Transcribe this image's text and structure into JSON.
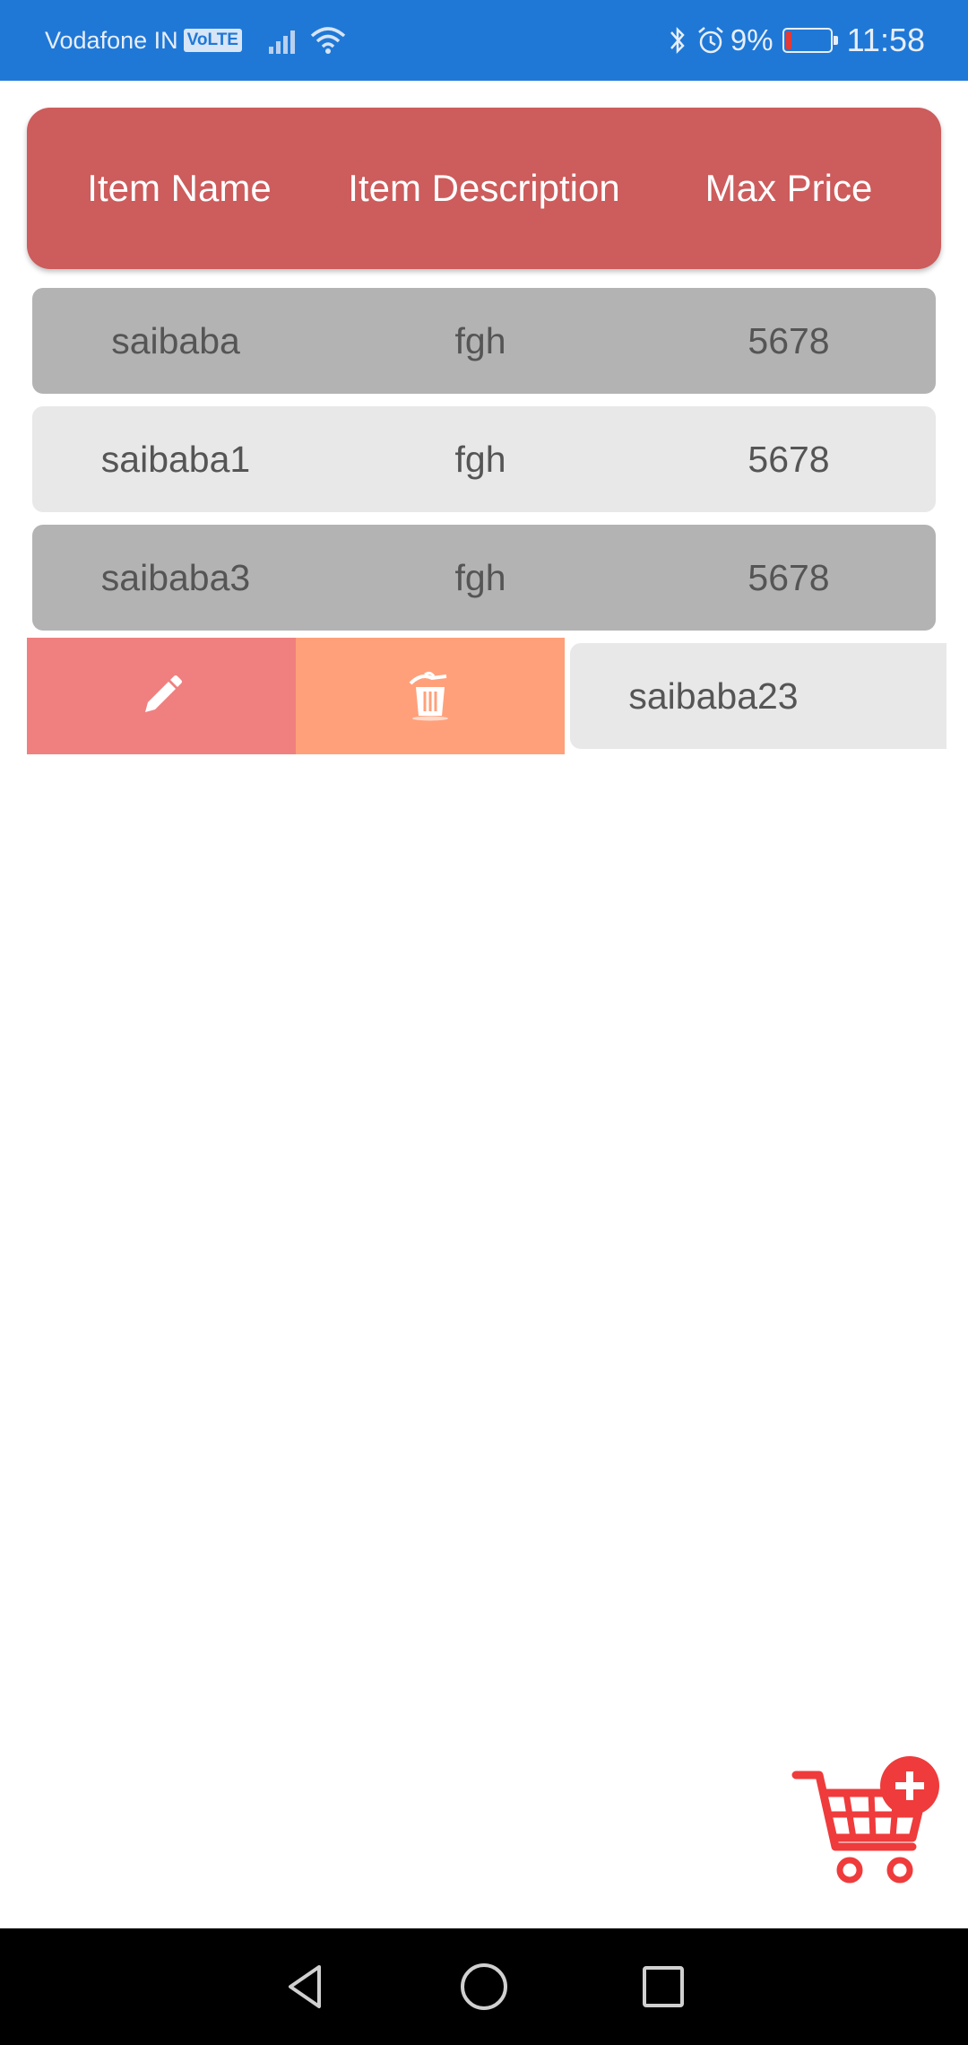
{
  "status_bar": {
    "carrier": "Vodafone IN",
    "volte": "VoLTE",
    "battery_percent": "9%",
    "time": "11:58",
    "icons": [
      "signal-icon",
      "wifi-icon",
      "bluetooth-icon",
      "alarm-icon",
      "battery-icon"
    ]
  },
  "table": {
    "headers": {
      "name": "Item Name",
      "description": "Item Description",
      "price": "Max Price"
    },
    "rows": [
      {
        "name": "saibaba",
        "description": "fgh",
        "price": "5678"
      },
      {
        "name": "saibaba1",
        "description": "fgh",
        "price": "5678"
      },
      {
        "name": "saibaba3",
        "description": "fgh",
        "price": "5678"
      }
    ],
    "swiped_row": {
      "name": "saibaba23"
    }
  },
  "swipe_actions": {
    "edit_icon": "pencil-icon",
    "delete_icon": "trash-icon",
    "edit_color": "#f08080",
    "delete_color": "#ffa07a"
  },
  "fab": {
    "icon": "add-to-cart-icon",
    "color": "#ef3b3b"
  },
  "colors": {
    "status_bar": "#1f78d6",
    "header": "#cd5c5c",
    "row_dark": "#b3b3b3",
    "row_light": "#e8e8e8"
  }
}
